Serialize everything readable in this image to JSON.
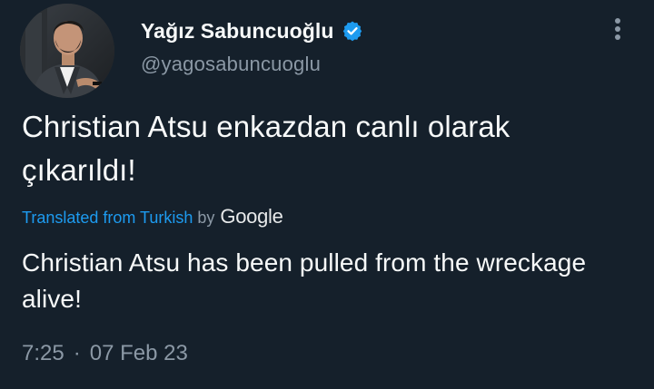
{
  "author": {
    "display_name": "Yağız Sabuncuoğlu",
    "handle": "@yagosabuncuoglu",
    "avatar_icon": "profile-photo",
    "verified_icon": "verified-badge-icon",
    "verified_color": "#1d9bf0"
  },
  "menu": {
    "icon": "more-vertical-icon"
  },
  "tweet": {
    "text": "Christian Atsu enkazdan canlı olarak çıkarıldı!",
    "translation_label": "Translated from Turkish",
    "translation_by": "by",
    "translation_provider": "Google",
    "translated_text": "Christian Atsu has been pulled from the wreckage alive!",
    "time": "7:25",
    "separator": "·",
    "date": "07 Feb 23"
  },
  "colors": {
    "background": "#15202b",
    "text_primary": "#f7f9f9",
    "text_secondary": "#8b98a5",
    "accent": "#1d9bf0"
  }
}
